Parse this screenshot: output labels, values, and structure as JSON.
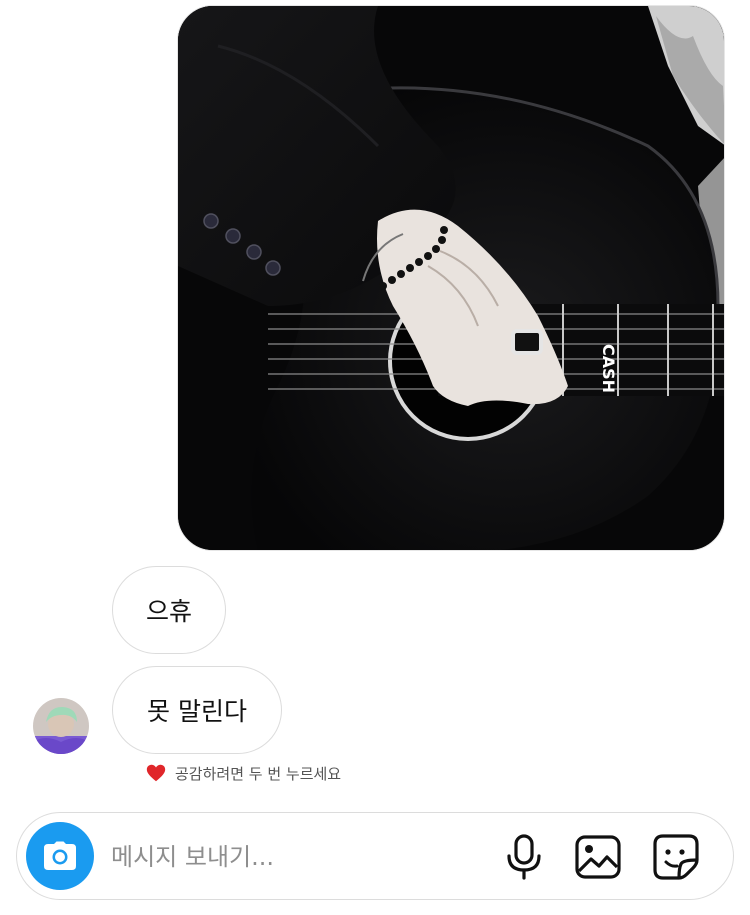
{
  "thread": {
    "image_alt": "",
    "messages": [
      {
        "text": "으휴"
      },
      {
        "text": "못 말린다"
      }
    ],
    "reaction_hint": "공감하려면 두 번 누르세요"
  },
  "composer": {
    "placeholder": "메시지 보내기...",
    "value": "",
    "icons": [
      "camera-icon",
      "microphone-icon",
      "gallery-icon",
      "sticker-icon"
    ]
  },
  "colors": {
    "accent": "#1a9bf0",
    "heart": "#e0262a",
    "bubble_border": "#dcdcdc",
    "placeholder": "#8e8e8e"
  }
}
